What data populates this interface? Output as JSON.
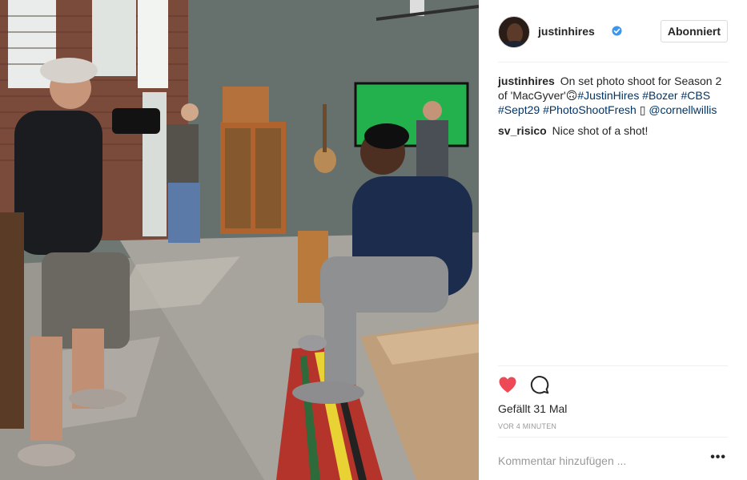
{
  "post": {
    "username": "justinhires",
    "follow_label": "Abonniert",
    "caption_parts": {
      "text": "On set photo shoot for Season 2 of 'MacGyver'",
      "emoji": "🙃",
      "tag1": "#JustinHires",
      "tag2": "#Bozer",
      "tag3": "#CBS",
      "tag4": "#Sept29",
      "tag5": "#PhotoShootFresh",
      "box": "▯",
      "mention": "@cornellwillis"
    },
    "comments": [
      {
        "author": "sv_risico",
        "text": "Nice shot of a shot!"
      }
    ],
    "likes_text": "Gefällt 31 Mal",
    "time_text": "VOR 4 MINUTEN",
    "comment_placeholder": "Kommentar hinzufügen ...",
    "more_label": "•••"
  },
  "icons": {
    "like": "heart-icon",
    "comment": "speech-bubble-icon",
    "verified": "verified-badge-icon",
    "more": "ellipsis-icon"
  },
  "colors": {
    "like_red": "#ed4956",
    "link_blue": "#003569",
    "verified_blue": "#3897f0",
    "muted": "#999999"
  }
}
